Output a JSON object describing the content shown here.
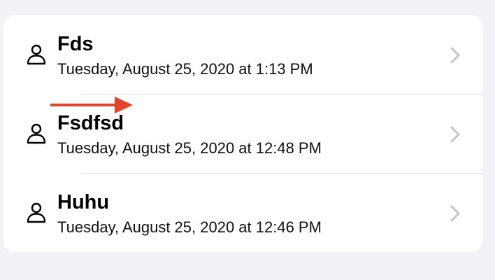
{
  "list": {
    "items": [
      {
        "title": "Fds",
        "subtitle": "Tuesday, August 25, 2020 at 1:13 PM",
        "icon": "person-icon",
        "accessory": "chevron-right-icon"
      },
      {
        "title": "Fsdfsd",
        "subtitle": "Tuesday, August 25, 2020 at 12:48 PM",
        "icon": "person-icon",
        "accessory": "chevron-right-icon"
      },
      {
        "title": "Huhu",
        "subtitle": "Tuesday, August 25, 2020 at 12:46 PM",
        "icon": "person-icon",
        "accessory": "chevron-right-icon"
      }
    ]
  },
  "annotation": {
    "icon": "red-arrow-icon",
    "color": "#e5432a"
  },
  "colors": {
    "background": "#f2f2f7",
    "card": "#ffffff",
    "chevron": "#c4c4c7",
    "divider": "#d7d7dc"
  }
}
